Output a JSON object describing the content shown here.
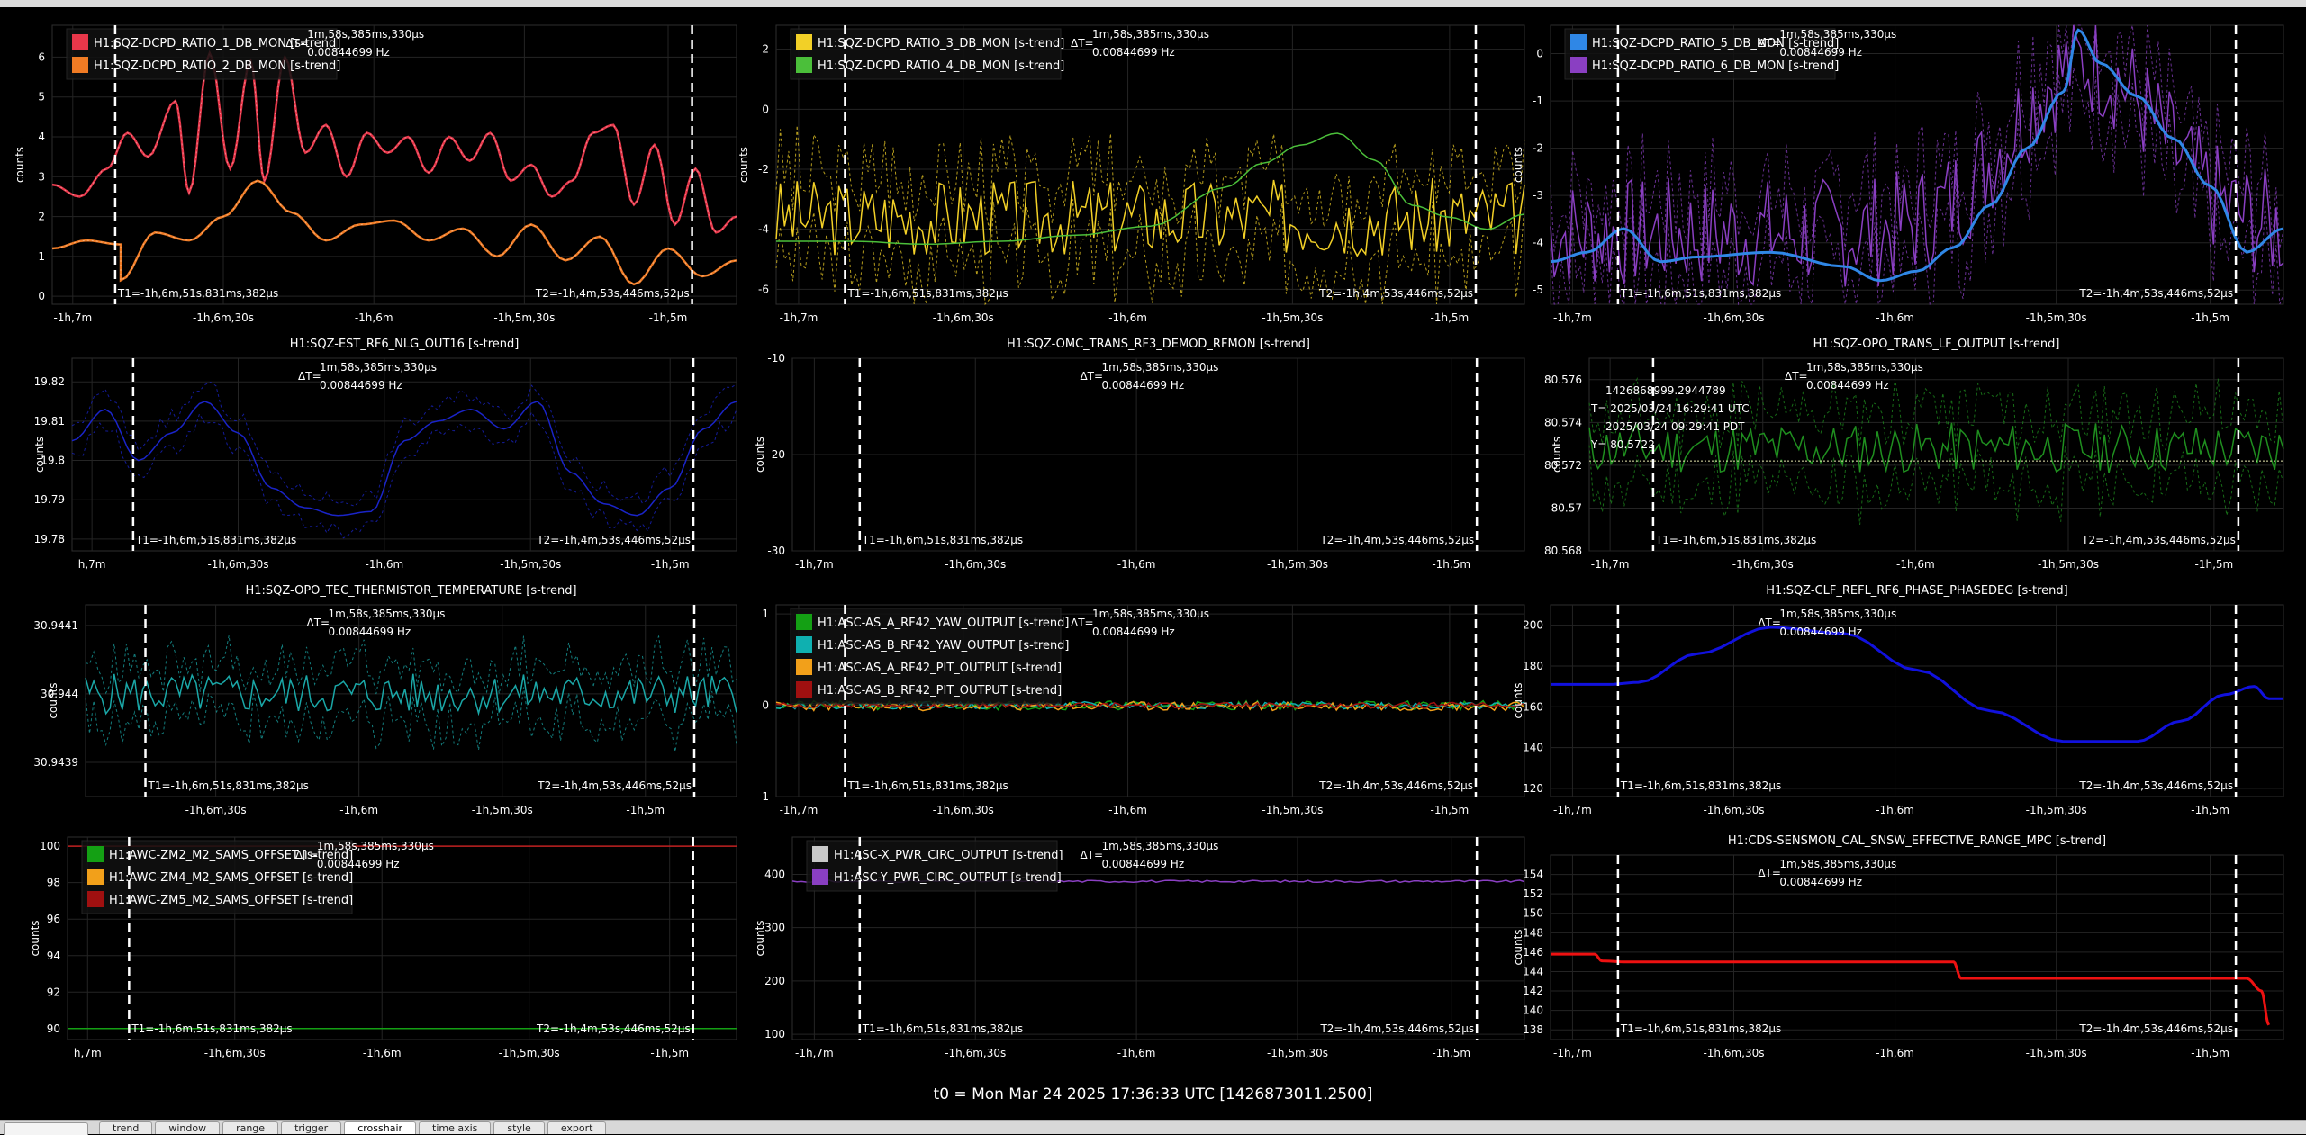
{
  "dt_text": "ΔT=",
  "dt_value": "1m,58s,385ms,330µs",
  "dt_freq": "0.00844699 Hz",
  "t1_text": "T1=-1h,6m,51s,831ms,382µs",
  "t2_text": "T2=-1h,4m,53s,446ms,52µs",
  "t0_text": "t0 = Mon Mar 24 2025 17:36:33 UTC [1426873011.2500]",
  "tabs": [
    "trend",
    "window",
    "range",
    "trigger",
    "crosshair",
    "time axis",
    "style",
    "export"
  ],
  "active_tab": "crosshair",
  "colors": {
    "background": "#000000",
    "grid": "#262626",
    "cursor": "#ffffff",
    "text": "#ffffff"
  },
  "chart_data": [
    {
      "type": "line",
      "title": "",
      "ylabel": "counts",
      "ylim": [
        -0.2,
        6.8
      ],
      "yticks": [
        0,
        1,
        2,
        3,
        4,
        5,
        6
      ],
      "xticks": [
        "-1h,7m",
        "-1h,6m,30s",
        "-1h,6m",
        "-1h,5m,30s",
        "-1h,5m"
      ],
      "legend": [
        {
          "name": "H1:SQZ-DCPD_RATIO_1_DB_MON [s-trend]",
          "color": "#e8374a"
        },
        {
          "name": "H1:SQZ-DCPD_RATIO_2_DB_MON [s-trend]",
          "color": "#f07b24"
        }
      ],
      "series": [
        {
          "name": "H1:SQZ-DCPD_RATIO_1_DB_MON [s-trend]",
          "color": "#e8374a",
          "x": [
            0,
            0.04,
            0.08,
            0.11,
            0.14,
            0.18,
            0.2,
            0.23,
            0.26,
            0.29,
            0.31,
            0.34,
            0.37,
            0.4,
            0.43,
            0.46,
            0.49,
            0.52,
            0.55,
            0.58,
            0.61,
            0.64,
            0.67,
            0.7,
            0.73,
            0.76,
            0.79,
            0.82,
            0.85,
            0.88,
            0.91,
            0.94,
            0.97,
            1.0
          ],
          "y": [
            2.8,
            2.5,
            3.2,
            4.1,
            3.5,
            4.9,
            2.6,
            6.1,
            3.2,
            5.9,
            2.9,
            6.0,
            3.6,
            4.3,
            3.0,
            4.1,
            3.6,
            4.0,
            3.1,
            4.0,
            3.4,
            4.1,
            2.9,
            3.3,
            2.5,
            2.9,
            4.1,
            4.3,
            2.3,
            3.8,
            1.8,
            3.2,
            1.6,
            2.0
          ],
          "dashed": true
        },
        {
          "name": "H1:SQZ-DCPD_RATIO_2_DB_MON [s-trend]",
          "color": "#f07b24",
          "x": [
            0,
            0.05,
            0.1,
            0.1,
            0.15,
            0.2,
            0.25,
            0.3,
            0.35,
            0.4,
            0.45,
            0.5,
            0.55,
            0.6,
            0.65,
            0.7,
            0.75,
            0.8,
            0.85,
            0.9,
            0.95,
            1.0
          ],
          "y": [
            1.2,
            1.4,
            1.3,
            0.4,
            1.6,
            1.4,
            2.0,
            2.9,
            2.1,
            1.4,
            1.8,
            1.9,
            1.4,
            1.7,
            1.0,
            1.8,
            0.9,
            1.5,
            0.3,
            1.2,
            0.5,
            0.9
          ],
          "dashed": true
        }
      ]
    },
    {
      "type": "line",
      "title": "",
      "ylabel": "counts",
      "ylim": [
        -6.5,
        2.8
      ],
      "yticks": [
        2,
        0,
        -2,
        -4,
        -6
      ],
      "xticks": [
        "-1h,7m",
        "-1h,6m,30s",
        "-1h,6m",
        "-1h,5m,30s",
        "-1h,5m"
      ],
      "legend": [
        {
          "name": "H1:SQZ-DCPD_RATIO_3_DB_MON [s-trend]",
          "color": "#f2d027"
        },
        {
          "name": "H1:SQZ-DCPD_RATIO_4_DB_MON [s-trend]",
          "color": "#4bbf3a"
        }
      ],
      "series": [
        {
          "name": "H1:SQZ-DCPD_RATIO_3_DB_MON [s-trend]",
          "color": "#f2d027",
          "noise": {
            "seed": 3,
            "mean": -3.6,
            "amp": 1.3,
            "n": 180
          },
          "envelope": 2.0
        },
        {
          "name": "H1:SQZ-DCPD_RATIO_4_DB_MON [s-trend]",
          "color": "#4bbf3a",
          "x": [
            0,
            0.1,
            0.2,
            0.3,
            0.4,
            0.5,
            0.6,
            0.65,
            0.7,
            0.75,
            0.8,
            0.85,
            0.9,
            0.95,
            1.0
          ],
          "y": [
            -4.4,
            -4.4,
            -4.5,
            -4.4,
            -4.2,
            -3.9,
            -2.6,
            -1.8,
            -1.2,
            -0.8,
            -1.7,
            -3.2,
            -3.6,
            -4.0,
            -3.5
          ]
        }
      ]
    },
    {
      "type": "line",
      "title": "",
      "ylabel": "counts",
      "ylim": [
        -5.3,
        0.6
      ],
      "yticks": [
        0,
        -1,
        -2,
        -3,
        -4,
        -5
      ],
      "xticks": [
        "-1h,7m",
        "-1h,6m,30s",
        "-1h,6m",
        "-1h,5m,30s",
        "-1h,5m"
      ],
      "legend": [
        {
          "name": "H1:SQZ-DCPD_RATIO_5_DB_MON [s-trend]",
          "color": "#2f87e6"
        },
        {
          "name": "H1:SQZ-DCPD_RATIO_6_DB_MON [s-trend]",
          "color": "#8a3fc2"
        }
      ],
      "series": [
        {
          "name": "H1:SQZ-DCPD_RATIO_6_DB_MON [s-trend]",
          "color": "#8a3fc2",
          "noise": {
            "seed": 7,
            "mean": -3.8,
            "amp": 1.2,
            "n": 200,
            "trendPeak": [
              0.73,
              3.6
            ]
          },
          "envelope": 1.2
        },
        {
          "name": "H1:SQZ-DCPD_RATIO_5_DB_MON [s-trend]",
          "color": "#2f87e6",
          "x": [
            0,
            0.05,
            0.1,
            0.15,
            0.2,
            0.3,
            0.4,
            0.45,
            0.5,
            0.55,
            0.6,
            0.65,
            0.7,
            0.72,
            0.75,
            0.8,
            0.85,
            0.9,
            0.95,
            1.0
          ],
          "y": [
            -4.4,
            -4.2,
            -3.7,
            -4.4,
            -4.3,
            -4.2,
            -4.5,
            -4.8,
            -4.6,
            -4.1,
            -3.2,
            -2.0,
            -0.8,
            0.5,
            -0.2,
            -0.9,
            -1.8,
            -2.8,
            -4.2,
            -3.7
          ],
          "bold": true
        }
      ]
    },
    {
      "type": "line",
      "title": "H1:SQZ-EST_RF6_NLG_OUT16 [s-trend]",
      "ylabel": "counts",
      "ylim": [
        19.777,
        19.826
      ],
      "yticks": [
        19.82,
        19.81,
        19.8,
        19.79,
        19.78
      ],
      "xticks": [
        "h,7m",
        "-1h,6m,30s",
        "-1h,6m",
        "-1h,5m,30s",
        "-1h,5m"
      ],
      "series": [
        {
          "name": "H1:SQZ-EST_RF6_NLG_OUT16 [s-trend]",
          "color": "#1a24c9",
          "x": [
            0,
            0.05,
            0.1,
            0.15,
            0.2,
            0.25,
            0.3,
            0.35,
            0.4,
            0.45,
            0.5,
            0.55,
            0.6,
            0.65,
            0.7,
            0.75,
            0.8,
            0.85,
            0.9,
            0.95,
            1.0
          ],
          "y": [
            19.805,
            19.813,
            19.8,
            19.807,
            19.815,
            19.807,
            19.793,
            19.788,
            19.786,
            19.787,
            19.805,
            19.81,
            19.813,
            19.808,
            19.815,
            19.797,
            19.789,
            19.786,
            19.793,
            19.808,
            19.815
          ],
          "envelope": 0.006
        }
      ]
    },
    {
      "type": "line",
      "title": "H1:SQZ-OMC_TRANS_RF3_DEMOD_RFMON [s-trend]",
      "ylabel": "counts",
      "ylim": [
        -30,
        -10
      ],
      "yticks": [
        -10,
        -20,
        -30
      ],
      "xticks": [
        "-1h,7m",
        "-1h,6m,30s",
        "-1h,6m",
        "-1h,5m,30s",
        "-1h,5m"
      ],
      "series": []
    },
    {
      "type": "line",
      "title": "H1:SQZ-OPO_TRANS_LF_OUTPUT [s-trend]",
      "ylabel": "counts",
      "ylim": [
        80.568,
        80.577
      ],
      "yticks": [
        80.576,
        80.574,
        80.572,
        80.57,
        80.568
      ],
      "xticks": [
        "-1h,7m",
        "-1h,6m,30s",
        "-1h,6m",
        "-1h,5m,30s",
        "-1h,5m"
      ],
      "crosshair_info": [
        "1426868999.2944789",
        "T= 2025/03/24 16:29:41 UTC",
        "2025/03/24 09:29:41 PDT",
        "Y= 80.5722"
      ],
      "crosshair_y": 80.5722,
      "series": [
        {
          "name": "H1:SQZ-OPO_TRANS_LF_OUTPUT [s-trend]",
          "color": "#1f8f1f",
          "noise": {
            "seed": 11,
            "mean": 80.5728,
            "amp": 0.0012,
            "n": 160
          },
          "envelope": 0.0025
        }
      ]
    },
    {
      "type": "line",
      "title": "H1:SQZ-OPO_TEC_THERMISTOR_TEMPERATURE [s-trend]",
      "ylabel": "counts",
      "ylim": [
        30.94385,
        30.94413
      ],
      "yticks": [
        30.9441,
        30.944,
        30.9439
      ],
      "ytickv": [
        30.9441,
        30.944,
        30.9439
      ],
      "xticks": [
        "-1h,6m,30s",
        "-1h,6m",
        "-1h,5m,30s",
        "-1h,5m"
      ],
      "xtickpos": [
        0.2,
        0.42,
        0.64,
        0.86
      ],
      "series": [
        {
          "name": "H1:SQZ-OPO_TEC_THERMISTOR_TEMPERATURE [s-trend]",
          "color": "#1aa7a7",
          "noise": {
            "seed": 5,
            "mean": 30.944,
            "amp": 3e-05,
            "n": 160
          },
          "envelope": 6e-05
        }
      ]
    },
    {
      "type": "line",
      "title": "",
      "ylabel": "",
      "ylim": [
        -1,
        1.1
      ],
      "yticks": [
        1,
        0,
        -1
      ],
      "xticks": [
        "-1h,7m",
        "-1h,6m,30s",
        "-1h,6m",
        "-1h,5m,30s",
        "-1h,5m"
      ],
      "legend": [
        {
          "name": "H1:ASC-AS_A_RF42_YAW_OUTPUT [s-trend]",
          "color": "#14a014"
        },
        {
          "name": "H1:ASC-AS_B_RF42_YAW_OUTPUT [s-trend]",
          "color": "#0fb0b0"
        },
        {
          "name": "H1:ASC-AS_A_RF42_PIT_OUTPUT [s-trend]",
          "color": "#f2a01a"
        },
        {
          "name": "H1:ASC-AS_B_RF42_PIT_OUTPUT [s-trend]",
          "color": "#a01010"
        }
      ],
      "series": [
        {
          "name": "H1:ASC-AS_A_RF42_YAW_OUTPUT [s-trend]",
          "color": "#14a014",
          "noise": {
            "seed": 21,
            "mean": 0,
            "amp": 0.05,
            "n": 200
          }
        },
        {
          "name": "H1:ASC-AS_B_RF42_YAW_OUTPUT [s-trend]",
          "color": "#0fb0b0",
          "noise": {
            "seed": 22,
            "mean": 0,
            "amp": 0.04,
            "n": 200
          }
        },
        {
          "name": "H1:ASC-AS_A_RF42_PIT_OUTPUT [s-trend]",
          "color": "#f2a01a",
          "noise": {
            "seed": 23,
            "mean": -0.01,
            "amp": 0.05,
            "n": 200
          }
        },
        {
          "name": "H1:ASC-AS_B_RF42_PIT_OUTPUT [s-trend]",
          "color": "#a01010",
          "noise": {
            "seed": 24,
            "mean": 0,
            "amp": 0.03,
            "n": 200
          }
        }
      ]
    },
    {
      "type": "line",
      "title": "H1:SQZ-CLF_REFL_RF6_PHASE_PHASEDEG [s-trend]",
      "ylabel": "counts",
      "ylim": [
        116,
        210
      ],
      "yticks": [
        200,
        180,
        160,
        140,
        120
      ],
      "xticks": [
        "-1h,7m",
        "-1h,6m,30s",
        "-1h,6m",
        "-1h,5m,30s",
        "-1h,5m"
      ],
      "series": [
        {
          "name": "H1:SQZ-CLF_REFL_RF6_PHASE_PHASEDEG [s-trend]",
          "color": "#1111dd",
          "x": [
            0,
            0.08,
            0.12,
            0.2,
            0.3,
            0.4,
            0.5,
            0.6,
            0.7,
            0.8,
            0.86,
            0.92,
            0.96,
            0.98,
            1.0
          ],
          "y": [
            171,
            171,
            172,
            186,
            199,
            196,
            178,
            158,
            143,
            143,
            153,
            166,
            170,
            164,
            164
          ],
          "bold": true
        }
      ]
    },
    {
      "type": "line",
      "title": "",
      "ylabel": "counts",
      "ylim": [
        89.4,
        100.5
      ],
      "yticks": [
        100,
        98,
        96,
        94,
        92,
        90
      ],
      "xticks": [
        "h,7m",
        "-1h,6m,30s",
        "-1h,6m",
        "-1h,5m,30s",
        "-1h,5m"
      ],
      "legend": [
        {
          "name": "H1:AWC-ZM2_M2_SAMS_OFFSET [s-trend]",
          "color": "#14a014"
        },
        {
          "name": "H1:AWC-ZM4_M2_SAMS_OFFSET [s-trend]",
          "color": "#f2a01a"
        },
        {
          "name": "H1:AWC-ZM5_M2_SAMS_OFFSET [s-trend]",
          "color": "#a01010"
        }
      ],
      "series": [
        {
          "name": "H1:AWC-ZM2_M2_SAMS_OFFSET [s-trend]",
          "color": "#14a014",
          "x": [
            0,
            1
          ],
          "y": [
            90,
            90
          ]
        },
        {
          "name": "H1:AWC-ZM5_M2_SAMS_OFFSET [s-trend]",
          "color": "#c02020",
          "x": [
            0,
            1
          ],
          "y": [
            100,
            100
          ]
        }
      ]
    },
    {
      "type": "line",
      "title": "",
      "ylabel": "counts",
      "ylim": [
        90,
        470
      ],
      "yticks": [
        400,
        300,
        200,
        100
      ],
      "xticks": [
        "-1h,7m",
        "-1h,6m,30s",
        "-1h,6m",
        "-1h,5m,30s",
        "-1h,5m"
      ],
      "legend": [
        {
          "name": "H1:ASC-X_PWR_CIRC_OUTPUT [s-trend]",
          "color": "#c8c8c8"
        },
        {
          "name": "H1:ASC-Y_PWR_CIRC_OUTPUT [s-trend]",
          "color": "#8a3fc2"
        }
      ],
      "series": [
        {
          "name": "H1:ASC-Y_PWR_CIRC_OUTPUT [s-trend]",
          "color": "#8a3fc2",
          "noise": {
            "seed": 31,
            "mean": 387,
            "amp": 2,
            "n": 160
          }
        }
      ]
    },
    {
      "type": "line",
      "title": "H1:CDS-SENSMON_CAL_SNSW_EFFECTIVE_RANGE_MPC [s-trend]",
      "ylabel": "counts",
      "ylim": [
        137,
        156
      ],
      "yticks": [
        154,
        152,
        150,
        148,
        146,
        144,
        142,
        140,
        138
      ],
      "xticks": [
        "-1h,7m",
        "-1h,6m,30s",
        "-1h,6m",
        "-1h,5m,30s",
        "-1h,5m"
      ],
      "series": [
        {
          "name": "H1:CDS-SENSMON_CAL_SNSW_EFFECTIVE_RANGE_MPC [s-trend]",
          "color": "#ee1111",
          "x": [
            0,
            0.06,
            0.07,
            0.1,
            0.3,
            0.5,
            0.55,
            0.56,
            0.6,
            0.8,
            0.95,
            0.97,
            0.98
          ],
          "y": [
            145.8,
            145.8,
            145.1,
            145.0,
            145.0,
            145.0,
            145.0,
            143.3,
            143.3,
            143.3,
            143.3,
            142.0,
            138.5
          ],
          "bold": true
        }
      ]
    }
  ]
}
